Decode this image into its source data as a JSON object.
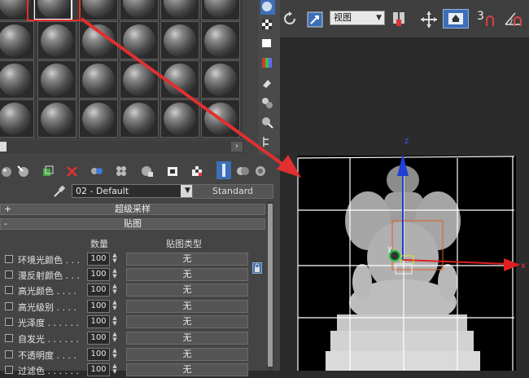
{
  "material_editor": {
    "material_name": "02 - Default",
    "material_type_button": "Standard",
    "rollouts": {
      "supersampling": {
        "sign": "+",
        "title": "超级采样"
      },
      "maps": {
        "sign": "-",
        "title": "贴图"
      }
    },
    "maps_table": {
      "headers": {
        "amount": "数量",
        "map_type": "贴图类型"
      },
      "rows": [
        {
          "label": "环境光颜色 . . .",
          "amount": "100",
          "map": "无"
        },
        {
          "label": "漫反射颜色 . . .",
          "amount": "100",
          "map": "无"
        },
        {
          "label": "高光颜色 . . . .",
          "amount": "100",
          "map": "无"
        },
        {
          "label": "高光级别 . . . .",
          "amount": "100",
          "map": "无"
        },
        {
          "label": "光泽度 . . . . . .",
          "amount": "100",
          "map": "无"
        },
        {
          "label": "自发光 . . . . . .",
          "amount": "100",
          "map": "无"
        },
        {
          "label": "不透明度 . . . .",
          "amount": "100",
          "map": "无"
        },
        {
          "label": "过滤色 . . . . . .",
          "amount": "100",
          "map": "无"
        }
      ]
    }
  },
  "viewport": {
    "view_dropdown": "视图",
    "snap_label": "3",
    "axis_labels": {
      "z": "z",
      "y": "y",
      "x": "x"
    }
  },
  "colors": {
    "panel_bg": "#444444",
    "highlight_red": "#e0302a",
    "gizmo_blue": "#1f3fd6",
    "gizmo_red": "#e02020",
    "gizmo_green": "#20c040",
    "gizmo_yellow": "#e0e030",
    "active_tool_blue": "#3d6fb8"
  },
  "icons": [
    "sample-sphere-icon",
    "checker-background-icon",
    "backlight-icon",
    "put-to-scene-icon",
    "assign-material-icon",
    "reset-map-icon",
    "delete-icon",
    "make-unique-icon",
    "put-to-library-icon",
    "material-id-icon",
    "show-map-icon",
    "show-end-result-icon",
    "go-to-parent-icon",
    "go-forward-icon",
    "eyedropper-icon",
    "lock-icon",
    "rotate-icon",
    "select-and-move-icon",
    "reference-coord-icon",
    "pivot-icon",
    "snap-toggle-icon",
    "angle-snap-icon"
  ]
}
